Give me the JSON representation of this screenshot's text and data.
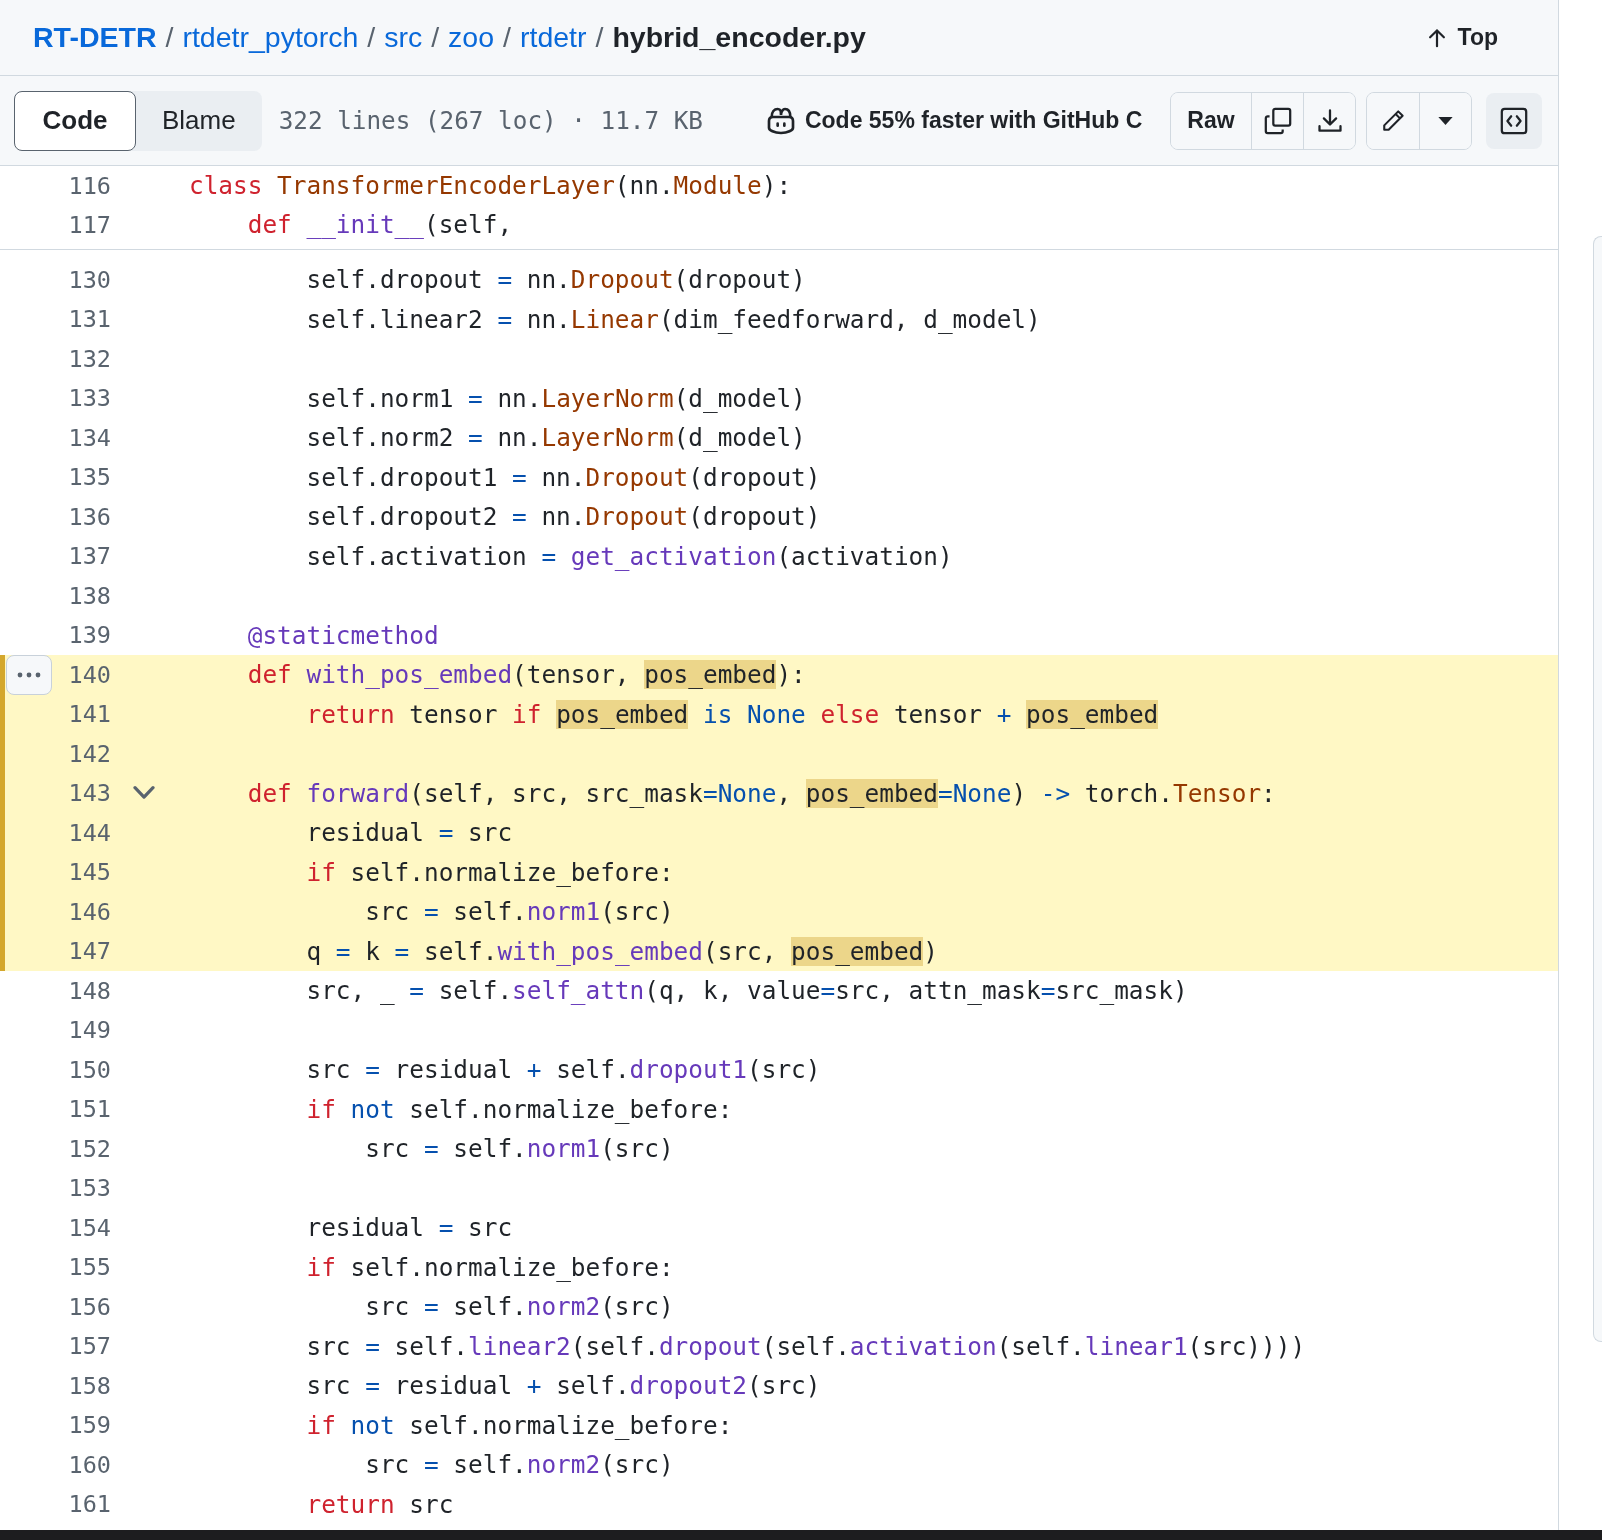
{
  "breadcrumb": [
    {
      "text": "RT-DETR",
      "kind": "repo"
    },
    {
      "text": "/",
      "kind": "separator"
    },
    {
      "text": "rtdetr_pytorch",
      "kind": "folder"
    },
    {
      "text": "/",
      "kind": "separator"
    },
    {
      "text": "src",
      "kind": "folder"
    },
    {
      "text": "/",
      "kind": "separator"
    },
    {
      "text": "zoo",
      "kind": "folder"
    },
    {
      "text": "/",
      "kind": "separator"
    },
    {
      "text": "rtdetr",
      "kind": "folder"
    },
    {
      "text": "/",
      "kind": "separator"
    },
    {
      "text": "hybrid_encoder.py",
      "kind": "file"
    }
  ],
  "top_link": {
    "label": "Top"
  },
  "toolbar": {
    "tabs": [
      {
        "label": "Code",
        "selected": true
      },
      {
        "label": "Blame",
        "selected": false
      }
    ],
    "file_info": "322 lines (267 loc) · 11.7 KB",
    "copilot_promo": "Code 55% faster with GitHub C",
    "raw_button": "Raw"
  },
  "sticky_lines": [
    {
      "number": "116",
      "code": [
        {
          "text": "class ",
          "kind": "keyword"
        },
        {
          "text": "TransformerEncoderLayer",
          "kind": "class"
        },
        {
          "text": "(nn.",
          "kind": "text"
        },
        {
          "text": "Module",
          "kind": "class"
        },
        {
          "text": "):",
          "kind": "text"
        }
      ]
    },
    {
      "number": "117",
      "code": [
        {
          "text": "    def ",
          "kind": "keyword"
        },
        {
          "text": "__init__",
          "kind": "function"
        },
        {
          "text": "(self,",
          "kind": "text"
        }
      ]
    }
  ],
  "lines": [
    {
      "number": "130",
      "selected": false,
      "code": [
        {
          "text": "        self.dropout ",
          "kind": "text"
        },
        {
          "text": "=",
          "kind": "constant"
        },
        {
          "text": " nn.",
          "kind": "text"
        },
        {
          "text": "Dropout",
          "kind": "class"
        },
        {
          "text": "(dropout)",
          "kind": "text"
        }
      ]
    },
    {
      "number": "131",
      "selected": false,
      "code": [
        {
          "text": "        self.linear2 ",
          "kind": "text"
        },
        {
          "text": "=",
          "kind": "constant"
        },
        {
          "text": " nn.",
          "kind": "text"
        },
        {
          "text": "Linear",
          "kind": "class"
        },
        {
          "text": "(dim_feedforward, d_model)",
          "kind": "text"
        }
      ]
    },
    {
      "number": "132",
      "selected": false
    },
    {
      "number": "133",
      "selected": false,
      "code": [
        {
          "text": "        self.norm1 ",
          "kind": "text"
        },
        {
          "text": "=",
          "kind": "constant"
        },
        {
          "text": " nn.",
          "kind": "text"
        },
        {
          "text": "LayerNorm",
          "kind": "class"
        },
        {
          "text": "(d_model)",
          "kind": "text"
        }
      ]
    },
    {
      "number": "134",
      "selected": false,
      "code": [
        {
          "text": "        self.norm2 ",
          "kind": "text"
        },
        {
          "text": "=",
          "kind": "constant"
        },
        {
          "text": " nn.",
          "kind": "text"
        },
        {
          "text": "LayerNorm",
          "kind": "class"
        },
        {
          "text": "(d_model)",
          "kind": "text"
        }
      ]
    },
    {
      "number": "135",
      "selected": false,
      "code": [
        {
          "text": "        self.dropout1 ",
          "kind": "text"
        },
        {
          "text": "=",
          "kind": "constant"
        },
        {
          "text": " nn.",
          "kind": "text"
        },
        {
          "text": "Dropout",
          "kind": "class"
        },
        {
          "text": "(dropout)",
          "kind": "text"
        }
      ]
    },
    {
      "number": "136",
      "selected": false,
      "code": [
        {
          "text": "        self.dropout2 ",
          "kind": "text"
        },
        {
          "text": "=",
          "kind": "constant"
        },
        {
          "text": " nn.",
          "kind": "text"
        },
        {
          "text": "Dropout",
          "kind": "class"
        },
        {
          "text": "(dropout)",
          "kind": "text"
        }
      ]
    },
    {
      "number": "137",
      "selected": false,
      "code": [
        {
          "text": "        self.activation ",
          "kind": "text"
        },
        {
          "text": "= ",
          "kind": "constant"
        },
        {
          "text": "get_activation",
          "kind": "function"
        },
        {
          "text": "(activation)",
          "kind": "text"
        }
      ]
    },
    {
      "number": "138",
      "selected": false
    },
    {
      "number": "139",
      "selected": false,
      "code": [
        {
          "text": "    @staticmethod",
          "kind": "function"
        }
      ]
    },
    {
      "number": "140",
      "selected": true,
      "menu": true,
      "code": [
        {
          "text": "    def ",
          "kind": "keyword"
        },
        {
          "text": "with_pos_embed",
          "kind": "function"
        },
        {
          "text": "(tensor, ",
          "kind": "text"
        },
        {
          "text": "pos_embed",
          "kind": "match"
        },
        {
          "text": "):",
          "kind": "text"
        }
      ]
    },
    {
      "number": "141",
      "selected": true,
      "code": [
        {
          "text": "        return",
          "kind": "keyword"
        },
        {
          "text": " tensor ",
          "kind": "text"
        },
        {
          "text": "if ",
          "kind": "keyword"
        },
        {
          "text": "pos_embed",
          "kind": "match"
        },
        {
          "text": " is None ",
          "kind": "constant"
        },
        {
          "text": "else",
          "kind": "keyword"
        },
        {
          "text": " tensor ",
          "kind": "text"
        },
        {
          "text": "+ ",
          "kind": "constant"
        },
        {
          "text": "pos_embed",
          "kind": "match"
        }
      ]
    },
    {
      "number": "142",
      "selected": true
    },
    {
      "number": "143",
      "selected": true,
      "fold_open": true,
      "code": [
        {
          "text": "    def ",
          "kind": "keyword"
        },
        {
          "text": "forward",
          "kind": "function"
        },
        {
          "text": "(self, src, src_mask",
          "kind": "text"
        },
        {
          "text": "=None",
          "kind": "constant"
        },
        {
          "text": ", ",
          "kind": "text"
        },
        {
          "text": "pos_embed",
          "kind": "match"
        },
        {
          "text": "=None",
          "kind": "constant"
        },
        {
          "text": ") ",
          "kind": "text"
        },
        {
          "text": "->",
          "kind": "constant"
        },
        {
          "text": " torch.",
          "kind": "text"
        },
        {
          "text": "Tensor",
          "kind": "class"
        },
        {
          "text": ":",
          "kind": "text"
        }
      ]
    },
    {
      "number": "144",
      "selected": true,
      "code": [
        {
          "text": "        residual ",
          "kind": "text"
        },
        {
          "text": "=",
          "kind": "constant"
        },
        {
          "text": " src",
          "kind": "text"
        }
      ]
    },
    {
      "number": "145",
      "selected": true,
      "code": [
        {
          "text": "        if",
          "kind": "keyword"
        },
        {
          "text": " self.normalize_before:",
          "kind": "text"
        }
      ]
    },
    {
      "number": "146",
      "selected": true,
      "code": [
        {
          "text": "            src ",
          "kind": "text"
        },
        {
          "text": "=",
          "kind": "constant"
        },
        {
          "text": " self.",
          "kind": "text"
        },
        {
          "text": "norm1",
          "kind": "function"
        },
        {
          "text": "(src)",
          "kind": "text"
        }
      ]
    },
    {
      "number": "147",
      "selected": true,
      "code": [
        {
          "text": "        q ",
          "kind": "text"
        },
        {
          "text": "=",
          "kind": "constant"
        },
        {
          "text": " k ",
          "kind": "text"
        },
        {
          "text": "=",
          "kind": "constant"
        },
        {
          "text": " self.",
          "kind": "text"
        },
        {
          "text": "with_pos_embed",
          "kind": "function"
        },
        {
          "text": "(src, ",
          "kind": "text"
        },
        {
          "text": "pos_embed",
          "kind": "match"
        },
        {
          "text": ")",
          "kind": "text"
        }
      ]
    },
    {
      "number": "148",
      "selected": false,
      "code": [
        {
          "text": "        src, _ ",
          "kind": "text"
        },
        {
          "text": "=",
          "kind": "constant"
        },
        {
          "text": " self.",
          "kind": "text"
        },
        {
          "text": "self_attn",
          "kind": "function"
        },
        {
          "text": "(q, k, value",
          "kind": "text"
        },
        {
          "text": "=",
          "kind": "constant"
        },
        {
          "text": "src, attn_mask",
          "kind": "text"
        },
        {
          "text": "=",
          "kind": "constant"
        },
        {
          "text": "src_mask)",
          "kind": "text"
        }
      ]
    },
    {
      "number": "149",
      "selected": false
    },
    {
      "number": "150",
      "selected": false,
      "code": [
        {
          "text": "        src ",
          "kind": "text"
        },
        {
          "text": "=",
          "kind": "constant"
        },
        {
          "text": " residual ",
          "kind": "text"
        },
        {
          "text": "+",
          "kind": "constant"
        },
        {
          "text": " self.",
          "kind": "text"
        },
        {
          "text": "dropout1",
          "kind": "function"
        },
        {
          "text": "(src)",
          "kind": "text"
        }
      ]
    },
    {
      "number": "151",
      "selected": false,
      "code": [
        {
          "text": "        if ",
          "kind": "keyword"
        },
        {
          "text": "not",
          "kind": "constant"
        },
        {
          "text": " self.normalize_before:",
          "kind": "text"
        }
      ]
    },
    {
      "number": "152",
      "selected": false,
      "code": [
        {
          "text": "            src ",
          "kind": "text"
        },
        {
          "text": "=",
          "kind": "constant"
        },
        {
          "text": " self.",
          "kind": "text"
        },
        {
          "text": "norm1",
          "kind": "function"
        },
        {
          "text": "(src)",
          "kind": "text"
        }
      ]
    },
    {
      "number": "153",
      "selected": false
    },
    {
      "number": "154",
      "selected": false,
      "code": [
        {
          "text": "        residual ",
          "kind": "text"
        },
        {
          "text": "=",
          "kind": "constant"
        },
        {
          "text": " src",
          "kind": "text"
        }
      ]
    },
    {
      "number": "155",
      "selected": false,
      "code": [
        {
          "text": "        if",
          "kind": "keyword"
        },
        {
          "text": " self.normalize_before:",
          "kind": "text"
        }
      ]
    },
    {
      "number": "156",
      "selected": false,
      "code": [
        {
          "text": "            src ",
          "kind": "text"
        },
        {
          "text": "=",
          "kind": "constant"
        },
        {
          "text": " self.",
          "kind": "text"
        },
        {
          "text": "norm2",
          "kind": "function"
        },
        {
          "text": "(src)",
          "kind": "text"
        }
      ]
    },
    {
      "number": "157",
      "selected": false,
      "code": [
        {
          "text": "        src ",
          "kind": "text"
        },
        {
          "text": "=",
          "kind": "constant"
        },
        {
          "text": " self.",
          "kind": "text"
        },
        {
          "text": "linear2",
          "kind": "function"
        },
        {
          "text": "(self.",
          "kind": "text"
        },
        {
          "text": "dropout",
          "kind": "function"
        },
        {
          "text": "(self.",
          "kind": "text"
        },
        {
          "text": "activation",
          "kind": "function"
        },
        {
          "text": "(self.",
          "kind": "text"
        },
        {
          "text": "linear1",
          "kind": "function"
        },
        {
          "text": "(src))))",
          "kind": "text"
        }
      ]
    },
    {
      "number": "158",
      "selected": false,
      "code": [
        {
          "text": "        src ",
          "kind": "text"
        },
        {
          "text": "=",
          "kind": "constant"
        },
        {
          "text": " residual ",
          "kind": "text"
        },
        {
          "text": "+",
          "kind": "constant"
        },
        {
          "text": " self.",
          "kind": "text"
        },
        {
          "text": "dropout2",
          "kind": "function"
        },
        {
          "text": "(src)",
          "kind": "text"
        }
      ]
    },
    {
      "number": "159",
      "selected": false,
      "code": [
        {
          "text": "        if ",
          "kind": "keyword"
        },
        {
          "text": "not",
          "kind": "constant"
        },
        {
          "text": " self.normalize_before:",
          "kind": "text"
        }
      ]
    },
    {
      "number": "160",
      "selected": false,
      "code": [
        {
          "text": "            src ",
          "kind": "text"
        },
        {
          "text": "=",
          "kind": "constant"
        },
        {
          "text": " self.",
          "kind": "text"
        },
        {
          "text": "norm2",
          "kind": "function"
        },
        {
          "text": "(src)",
          "kind": "text"
        }
      ]
    },
    {
      "number": "161",
      "selected": false,
      "code": [
        {
          "text": "        return",
          "kind": "keyword"
        },
        {
          "text": " src",
          "kind": "text"
        }
      ]
    }
  ]
}
